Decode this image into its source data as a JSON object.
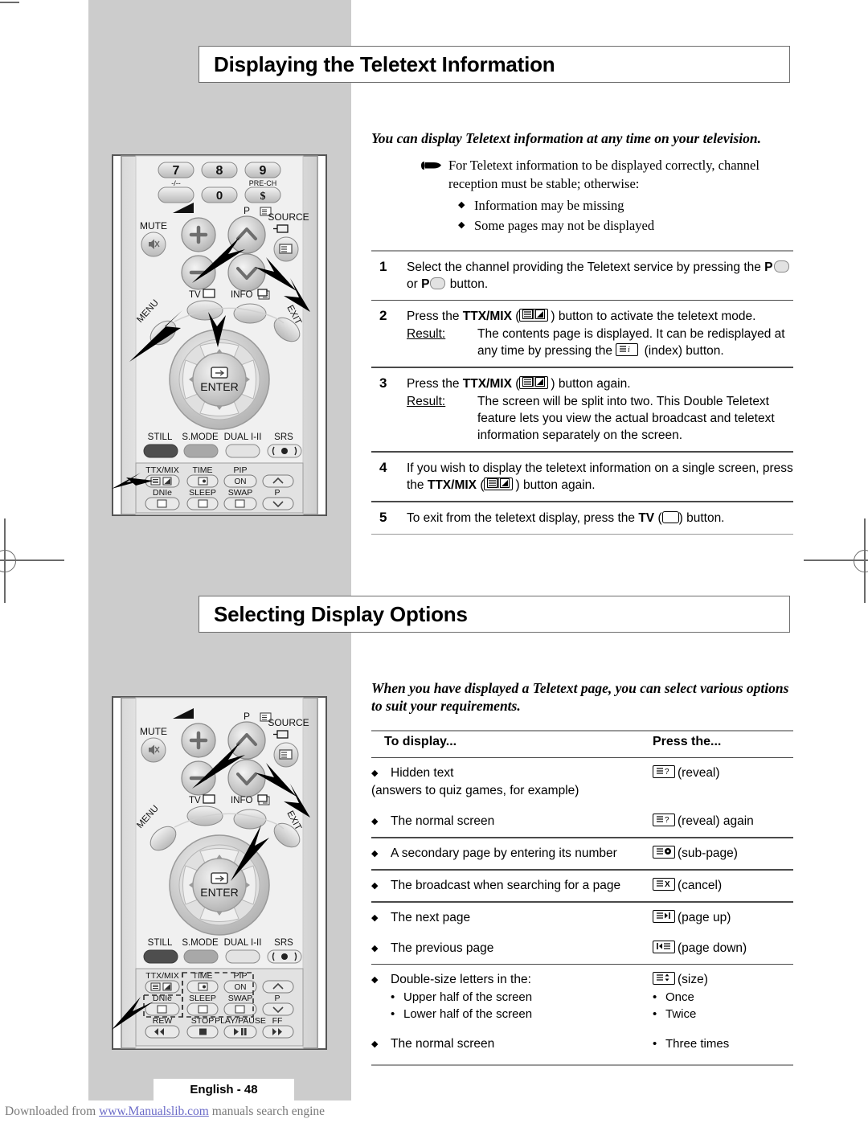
{
  "page": {
    "footer_label": "English - 48",
    "download_prefix": "Downloaded from ",
    "download_link": "www.Manualslib.com",
    "download_suffix": " manuals search engine"
  },
  "section1": {
    "title": "Displaying the Teletext Information",
    "intro": "You can display Teletext information at any time on your television.",
    "note": "For Teletext information to be displayed correctly, channel reception must be stable; otherwise:",
    "note_bullets": [
      "Information may be missing",
      "Some pages may not be displayed"
    ],
    "steps": [
      {
        "num": "1",
        "text_a": "Select the channel providing the Teletext service by pressing the ",
        "bold_a": "P",
        "mid": " or ",
        "bold_b": "P",
        "text_b": " button."
      },
      {
        "num": "2",
        "text_a": "Press the ",
        "bold_a": "TTX/MIX",
        "text_b": " ( ) button to activate the teletext mode.",
        "result_label": "Result:",
        "result_text": "The contents page is displayed. It can be redisplayed at any time by pressing the  (index) button."
      },
      {
        "num": "3",
        "text_a": "Press the ",
        "bold_a": "TTX/MIX",
        "text_b": " ( ) button again.",
        "result_label": "Result:",
        "result_text": "The screen will be split into two. This Double Teletext feature lets you view the actual broadcast and teletext information separately on the screen."
      },
      {
        "num": "4",
        "text_a": "If you wish to display the teletext information on a single screen, press the ",
        "bold_a": "TTX/MIX",
        "text_b": " ( ) button again."
      },
      {
        "num": "5",
        "text_a": "To exit from the teletext display, press the ",
        "bold_a": "TV",
        "text_b": " ( ) button."
      }
    ]
  },
  "section2": {
    "title": "Selecting Display Options",
    "intro": "When you have displayed a Teletext page, you can select various options to suit your requirements.",
    "table": {
      "header_left": "To display...",
      "header_right": "Press the...",
      "rows": [
        {
          "left": "Hidden text",
          "left_sub": "(answers to quiz games, for example)",
          "right_icon": "reveal-icon",
          "right": "(reveal)"
        },
        {
          "left": "The normal screen",
          "right_icon": "reveal-icon",
          "right": "(reveal) again"
        },
        {
          "left": "A secondary page by entering its number",
          "right_icon": "sub-page-icon",
          "right": "(sub-page)"
        },
        {
          "left": "The broadcast when searching for a page",
          "right_icon": "cancel-icon",
          "right": "(cancel)"
        },
        {
          "left": "The next page",
          "right_icon": "page-up-icon",
          "right": "(page up)"
        },
        {
          "left": "The previous page",
          "right_icon": "page-down-icon",
          "right": "(page down)"
        },
        {
          "left": "Double-size letters in the:",
          "left_items": [
            "Upper half of the screen",
            "Lower half of the screen"
          ],
          "right_icon": "size-icon",
          "right": "(size)",
          "right_items": [
            "Once",
            "Twice"
          ]
        },
        {
          "left": "The normal screen",
          "right_items": [
            "Three times"
          ]
        }
      ]
    }
  },
  "remote_top": {
    "numbers": [
      "7",
      "8",
      "9",
      "0"
    ],
    "num_sub_left": "-/--",
    "num_sub_right": "PRE-CH",
    "mute": "MUTE",
    "p_label": "P",
    "source": "SOURCE",
    "tv": "TV",
    "info": "INFO",
    "menu": "MENU",
    "exit": "EXIT",
    "enter": "ENTER",
    "row_still": [
      "STILL",
      "S.MODE",
      "DUAL I-II",
      "SRS"
    ],
    "row_ttx": [
      "TTX/MIX",
      "TIME",
      "PIP"
    ],
    "pip_on": "ON",
    "row_dnie": [
      "DNIe",
      "SLEEP",
      "SWAP",
      "P"
    ]
  },
  "remote_bottom": {
    "mute": "MUTE",
    "p_label": "P",
    "source": "SOURCE",
    "tv": "TV",
    "info": "INFO",
    "menu": "MENU",
    "exit": "EXIT",
    "enter": "ENTER",
    "row_still": [
      "STILL",
      "S.MODE",
      "DUAL I-II",
      "SRS"
    ],
    "row_ttx": [
      "TTX/MIX",
      "TIME",
      "PIP"
    ],
    "pip_on": "ON",
    "row_dnie": [
      "DNIe",
      "SLEEP",
      "SWAP",
      "P"
    ],
    "row_trans": [
      "REW",
      "STOP",
      "PLAY/PAUSE",
      "FF"
    ]
  },
  "colors": {
    "page_gray": "#cccccc",
    "rule_dark": "#4a4a4a",
    "rule_light": "#9a9a9a",
    "link": "#6b6bc8"
  }
}
